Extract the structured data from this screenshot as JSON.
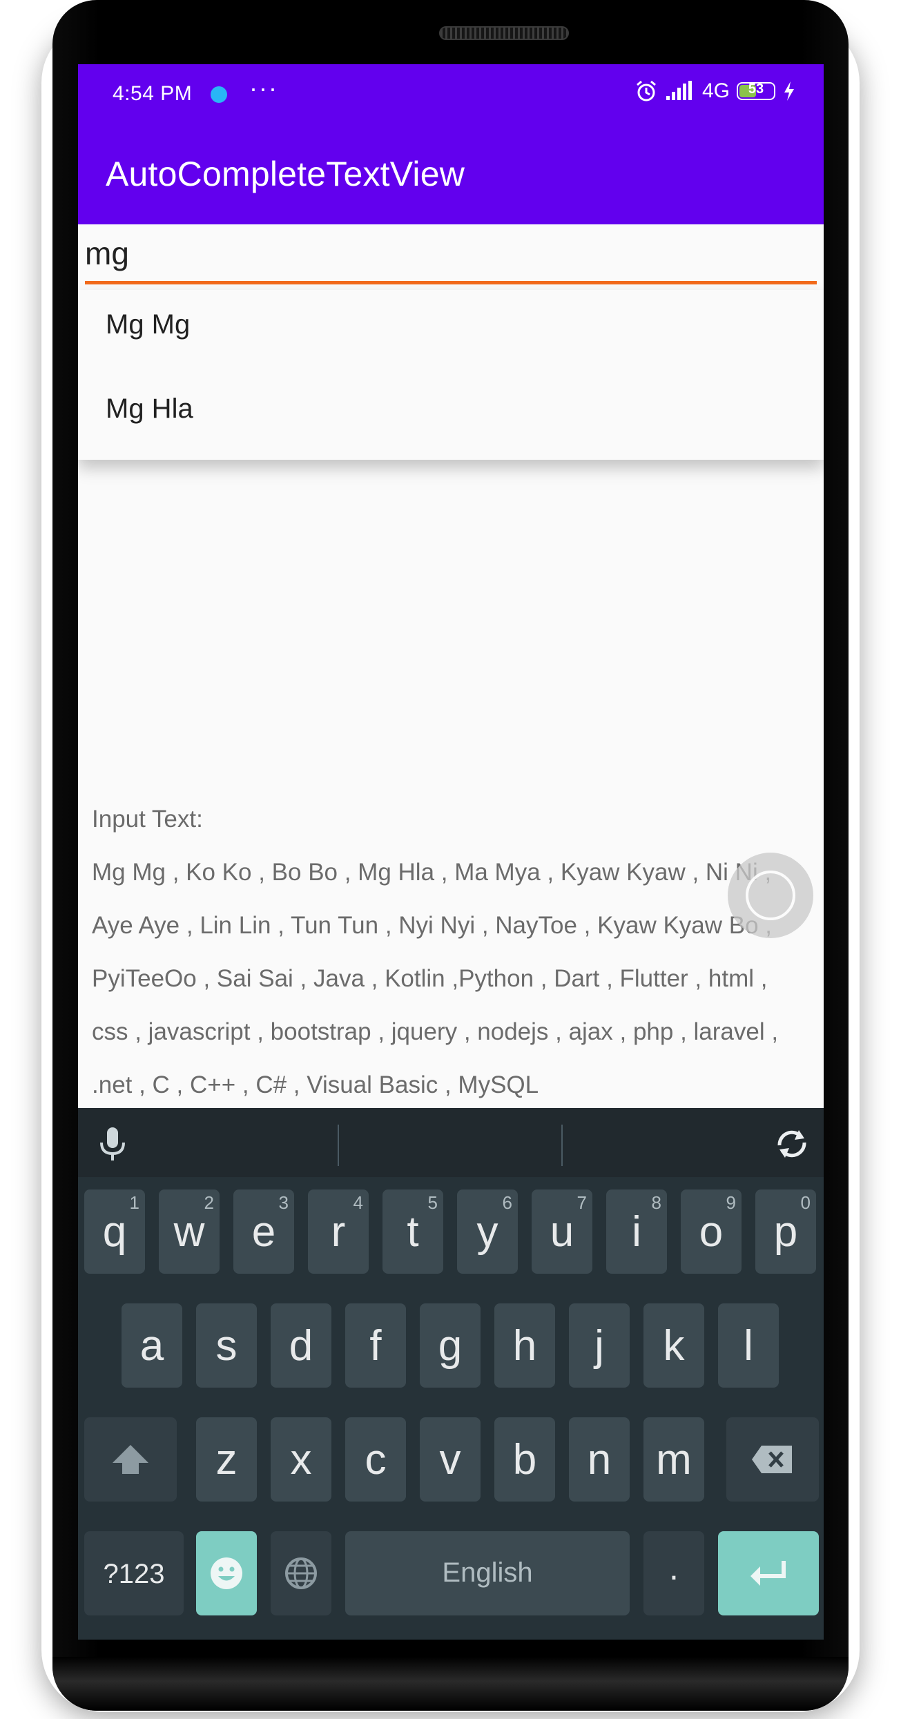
{
  "status_bar": {
    "time": "4:54 PM",
    "more": "···",
    "network": "4G",
    "battery": "53"
  },
  "app_bar": {
    "title": "AutoCompleteTextView"
  },
  "input": {
    "value": "mg"
  },
  "suggestions": [
    "Mg Mg",
    "Mg Hla"
  ],
  "output": {
    "label": "Input Text:",
    "text": " Mg Mg , Ko Ko , Bo Bo , Mg Hla , Ma Mya , Kyaw Kyaw , Ni Ni , Aye Aye , Lin Lin , Tun Tun , Nyi Nyi , NayToe , Kyaw Kyaw Bo , PyiTeeOo , Sai Sai , Java , Kotlin ,Python , Dart , Flutter , html , css , javascript , bootstrap , jquery , nodejs , ajax , php , laravel , .net , C , C++ , C# , Visual Basic , MySQL"
  },
  "keyboard": {
    "row1": [
      {
        "letter": "q",
        "num": "1"
      },
      {
        "letter": "w",
        "num": "2"
      },
      {
        "letter": "e",
        "num": "3"
      },
      {
        "letter": "r",
        "num": "4"
      },
      {
        "letter": "t",
        "num": "5"
      },
      {
        "letter": "y",
        "num": "6"
      },
      {
        "letter": "u",
        "num": "7"
      },
      {
        "letter": "i",
        "num": "8"
      },
      {
        "letter": "o",
        "num": "9"
      },
      {
        "letter": "p",
        "num": "0"
      }
    ],
    "row2": [
      "a",
      "s",
      "d",
      "f",
      "g",
      "h",
      "j",
      "k",
      "l"
    ],
    "row3": [
      "z",
      "x",
      "c",
      "v",
      "b",
      "n",
      "m"
    ],
    "symbols_label": "?123",
    "space_label": "English",
    "period_label": "."
  }
}
